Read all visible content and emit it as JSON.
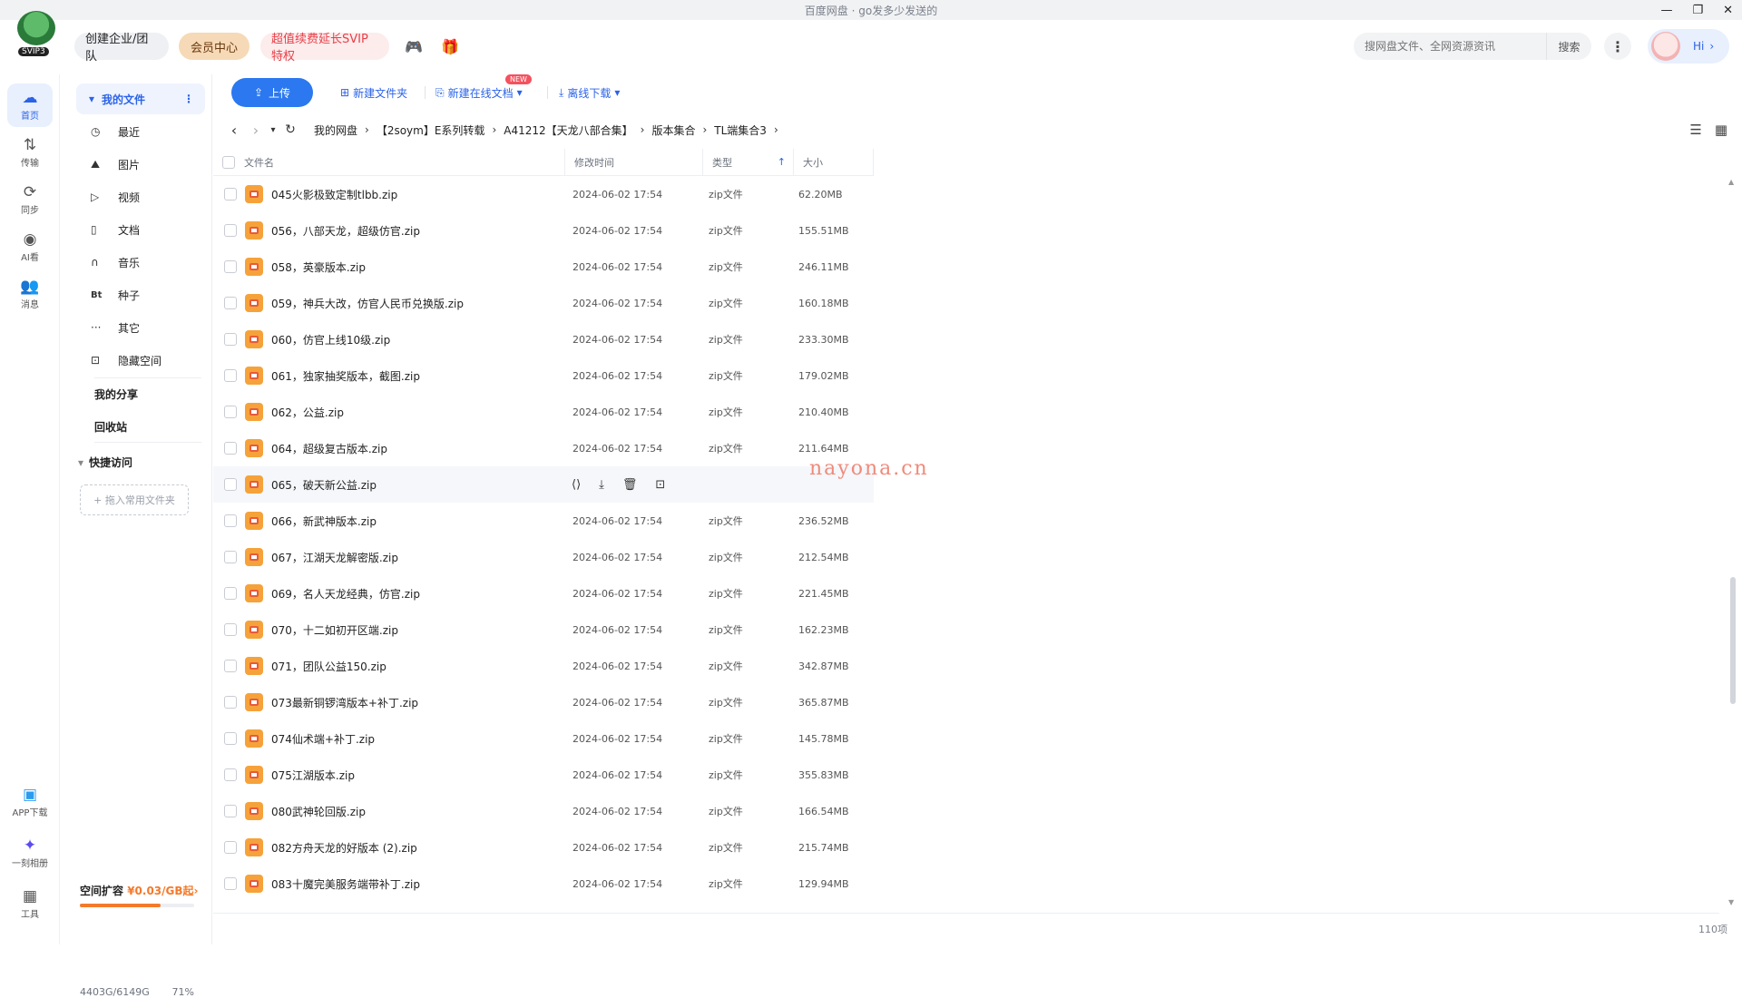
{
  "window": {
    "title": "百度网盘 · go发多少发送的"
  },
  "header": {
    "logo_badge": "SVIP3",
    "create_team": "创建企业/团队",
    "vip_center": "会员中心",
    "svip_promo": "超值续费延长SVIP特权",
    "search_placeholder": "搜网盘文件、全网资源资讯",
    "search_button": "搜索",
    "user_greeting": "Hi"
  },
  "rail": {
    "items": [
      {
        "label": "首页",
        "icon": "cloud-icon"
      },
      {
        "label": "传输",
        "icon": "transfer-icon"
      },
      {
        "label": "同步",
        "icon": "sync-icon"
      },
      {
        "label": "AI看",
        "icon": "ai-icon"
      },
      {
        "label": "消息",
        "icon": "message-icon"
      }
    ],
    "bottom_items": [
      {
        "label": "APP下载",
        "icon": "phone-icon"
      },
      {
        "label": "一刻相册",
        "icon": "album-icon"
      },
      {
        "label": "工具",
        "icon": "tools-icon"
      }
    ]
  },
  "sidebar": {
    "my_files": "我的文件",
    "items": [
      {
        "label": "最近",
        "glyph": "◷"
      },
      {
        "label": "图片",
        "glyph": "⛰"
      },
      {
        "label": "视频",
        "glyph": "▷"
      },
      {
        "label": "文档",
        "glyph": "▯"
      },
      {
        "label": "音乐",
        "glyph": "∩"
      },
      {
        "label": "种子",
        "glyph": "Bt"
      },
      {
        "label": "其它",
        "glyph": "···"
      },
      {
        "label": "隐藏空间",
        "glyph": "⊡"
      }
    ],
    "my_share": "我的分享",
    "recycle": "回收站",
    "quick_access": "快捷访问",
    "quick_add": "+ 拖入常用文件夹",
    "expand_label": "空间扩容",
    "expand_price": "¥0.03/GB起",
    "storage_text": "4403G/6149G",
    "storage_percent_text": "71%",
    "storage_fraction": 0.71
  },
  "toolbar": {
    "upload": "上传",
    "new_folder": "新建文件夹",
    "new_doc": "新建在线文档",
    "new_badge": "NEW",
    "offline": "离线下载"
  },
  "breadcrumb": [
    "我的网盘",
    "【2soym】E系列转载",
    "A41212【天龙八部合集】",
    "版本集合",
    "TL端集合3"
  ],
  "table": {
    "headers": {
      "name": "文件名",
      "modified": "修改时间",
      "type": "类型",
      "size": "大小"
    },
    "rows": [
      {
        "name": "045火影极致定制tlbb.zip",
        "date": "2024-06-02 17:54",
        "type": "zip文件",
        "size": "62.20MB"
      },
      {
        "name": "056，八部天龙，超级仿官.zip",
        "date": "2024-06-02 17:54",
        "type": "zip文件",
        "size": "155.51MB"
      },
      {
        "name": "058，英豪版本.zip",
        "date": "2024-06-02 17:54",
        "type": "zip文件",
        "size": "246.11MB"
      },
      {
        "name": "059，神兵大改，仿官人民币兑换版.zip",
        "date": "2024-06-02 17:54",
        "type": "zip文件",
        "size": "160.18MB"
      },
      {
        "name": "060，仿官上线10级.zip",
        "date": "2024-06-02 17:54",
        "type": "zip文件",
        "size": "233.30MB"
      },
      {
        "name": "061，独家抽奖版本，截图.zip",
        "date": "2024-06-02 17:54",
        "type": "zip文件",
        "size": "179.02MB"
      },
      {
        "name": "062，公益.zip",
        "date": "2024-06-02 17:54",
        "type": "zip文件",
        "size": "210.40MB"
      },
      {
        "name": "064，超级复古版本.zip",
        "date": "2024-06-02 17:54",
        "type": "zip文件",
        "size": "211.64MB"
      },
      {
        "name": "065，破天新公益.zip",
        "date": "",
        "type": "",
        "size": "",
        "hover": true
      },
      {
        "name": "066，新武神版本.zip",
        "date": "2024-06-02 17:54",
        "type": "zip文件",
        "size": "236.52MB"
      },
      {
        "name": "067，江湖天龙解密版.zip",
        "date": "2024-06-02 17:54",
        "type": "zip文件",
        "size": "212.54MB"
      },
      {
        "name": "069，名人天龙经典，仿官.zip",
        "date": "2024-06-02 17:54",
        "type": "zip文件",
        "size": "221.45MB"
      },
      {
        "name": "070，十二如初开区端.zip",
        "date": "2024-06-02 17:54",
        "type": "zip文件",
        "size": "162.23MB"
      },
      {
        "name": "071，团队公益150.zip",
        "date": "2024-06-02 17:54",
        "type": "zip文件",
        "size": "342.87MB"
      },
      {
        "name": "073最新铜锣湾版本+补丁.zip",
        "date": "2024-06-02 17:54",
        "type": "zip文件",
        "size": "365.87MB"
      },
      {
        "name": "074仙术端+补丁.zip",
        "date": "2024-06-02 17:54",
        "type": "zip文件",
        "size": "145.78MB"
      },
      {
        "name": "075江湖版本.zip",
        "date": "2024-06-02 17:54",
        "type": "zip文件",
        "size": "355.83MB"
      },
      {
        "name": "080武神轮回版.zip",
        "date": "2024-06-02 17:54",
        "type": "zip文件",
        "size": "166.54MB"
      },
      {
        "name": "082方舟天龙的好版本 (2).zip",
        "date": "2024-06-02 17:54",
        "type": "zip文件",
        "size": "215.74MB"
      },
      {
        "name": "083十魔完美服务端带补丁.zip",
        "date": "2024-06-02 17:54",
        "type": "zip文件",
        "size": "129.94MB"
      }
    ],
    "item_count": "110项"
  },
  "watermark": "nayona.cn"
}
